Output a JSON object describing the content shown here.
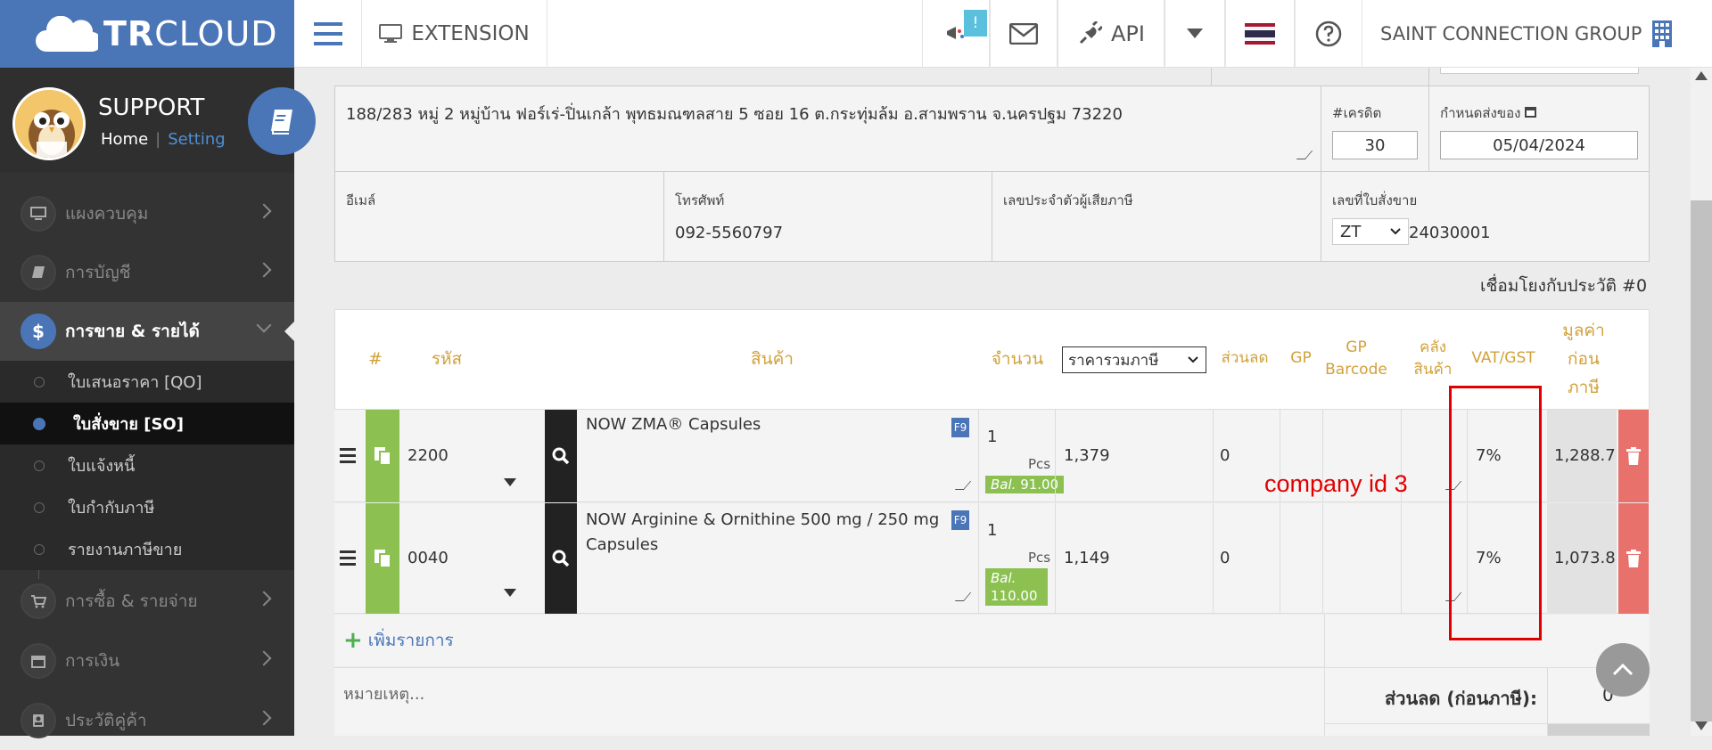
{
  "header": {
    "brand_bold": "TR",
    "brand_light": "CLOUD",
    "extension_label": "EXTENSION",
    "notification_badge": "!",
    "api_label": "API",
    "company_name": "SAINT CONNECTION GROUP"
  },
  "sidebar": {
    "user_name": "SUPPORT",
    "home_link": "Home",
    "separator": "|",
    "setting_link": "Setting",
    "nav": [
      {
        "label": "แผงควบคุม",
        "icon": "monitor-icon"
      },
      {
        "label": "การบัญชี",
        "icon": "book-icon"
      },
      {
        "label": "การขาย & รายได้",
        "icon": "dollar-icon"
      },
      {
        "label": "การซื้อ & รายจ่าย",
        "icon": "cart-icon"
      },
      {
        "label": "การเงิน",
        "icon": "calendar-icon"
      },
      {
        "label": "ประวัติคู่ค้า",
        "icon": "contact-icon"
      }
    ],
    "sub": [
      {
        "label": "ใบเสนอราคา [QO]"
      },
      {
        "label": "ใบสั่งขาย [SO]"
      },
      {
        "label": "ใบแจ้งหนี้"
      },
      {
        "label": "ใบกำกับภาษี"
      },
      {
        "label": "รายงานภาษีขาย"
      }
    ]
  },
  "form": {
    "address": "188/283 หมู่ 2 หมู่บ้าน ฟอร์เร่-ปิ่นเกล้า พุทธมณฑลสาย 5 ซอย 16 ต.กระทุ่มล้ม อ.สามพราน จ.นครปฐม 73220",
    "credit_label": "#เครดิต",
    "credit_value": "30",
    "delivery_label": "กำหนดส่งของ",
    "delivery_value": "05/04/2024",
    "email_label": "อีเมล์",
    "phone_label": "โทรศัพท์",
    "phone_value": "092-5560797",
    "taxid_label": "เลขประจำตัวผู้เสียภาษี",
    "so_label": "เลขที่ใบสั่งขาย",
    "so_prefix": "ZT",
    "so_number": "24030001",
    "link_history": "เชื่อมโยงกับประวัติ #0"
  },
  "table": {
    "headers": {
      "num": "#",
      "code": "รหัส",
      "product": "สินค้า",
      "qty": "จำนวน",
      "price_mode": "ราคารวมภาษี",
      "discount": "ส่วนลด",
      "gp": "GP",
      "gp_barcode_1": "GP",
      "gp_barcode_2": "Barcode",
      "warehouse_1": "คลัง",
      "warehouse_2": "สินค้า",
      "vat": "VAT/GST",
      "pretax_1": "มูลค่า",
      "pretax_2": "ก่อน",
      "pretax_3": "ภาษี"
    },
    "rows": [
      {
        "code": "2200",
        "product": "NOW ZMA® Capsules",
        "f9": "F9",
        "qty": "1",
        "unit": "Pcs",
        "bal_label": "Bal.",
        "bal_value": "91.00",
        "price": "1,379",
        "discount": "0",
        "vat": "7%",
        "pretax": "1,288.7"
      },
      {
        "code": "0040",
        "product": "NOW Arginine & Ornithine 500 mg / 250 mg Capsules",
        "f9": "F9",
        "qty": "1",
        "unit": "Pcs",
        "bal_label": "Bal.",
        "bal_value": "110.00",
        "price": "1,149",
        "discount": "0",
        "vat": "7%",
        "pretax": "1,073.8"
      }
    ],
    "add_item": "เพิ่มรายการ",
    "note_placeholder": "หมายเหตุ...",
    "discount_before_tax_label": "ส่วนลด (ก่อนภาษี):",
    "discount_before_tax_value": "0"
  },
  "annotation": {
    "text": "company id 3",
    "color": "#e00000"
  },
  "colors": {
    "brand": "#4a76b8",
    "sidebar": "#333333",
    "header_text": "#d1a13a",
    "green": "#8cc152",
    "delete": "#e8716c"
  }
}
